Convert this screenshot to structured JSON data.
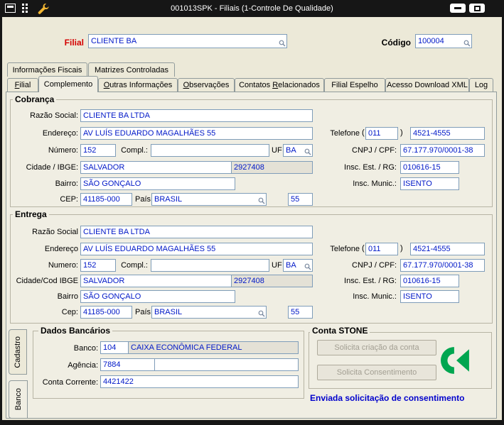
{
  "titlebar": {
    "title": "001013SPK - Filiais (1-Controle De Qualidade)"
  },
  "header": {
    "filial_label": "Filial",
    "filial_value": "CLIENTE BA",
    "codigo_label": "Código",
    "codigo_value": "100004"
  },
  "top_tabs": {
    "fiscais": "Informações Fiscais",
    "matrizes": "Matrizes Controladas"
  },
  "main_tabs": {
    "filial": {
      "label": "Filial",
      "u": "0"
    },
    "complemento": {
      "label": "Complemento"
    },
    "outras": {
      "label": "Outras Informações",
      "u": "0"
    },
    "observacoes": {
      "label": "Observações",
      "u": "0"
    },
    "contatos": {
      "label": "Contatos Relacionados",
      "u": "9"
    },
    "espelho": {
      "label": "Filial Espelho"
    },
    "xml": {
      "label": "Acesso Download XML"
    },
    "log": {
      "label": "Log"
    }
  },
  "cobranca": {
    "title": "Cobrança",
    "labels": {
      "razao": "Razão Social:",
      "endereco": "Endereço:",
      "numero": "Número:",
      "compl": "Compl.:",
      "uf": "UF",
      "cidade": "Cidade / IBGE:",
      "bairro": "Bairro:",
      "cep": "CEP:",
      "pais": "País",
      "telefone": "Telefone",
      "paren_open": "(",
      "paren_close": ")",
      "cnpj": "CNPJ / CPF:",
      "insc_est": "Insc. Est. / RG:",
      "insc_mun": "Insc. Munic.:"
    },
    "values": {
      "razao": "CLIENTE BA LTDA",
      "endereco": "AV LUÍS EDUARDO MAGALHÃES 55",
      "numero": "152",
      "compl": "",
      "uf": "BA",
      "cidade": "SALVADOR",
      "ibge": "2927408",
      "bairro": "SÃO GONÇALO",
      "cep": "41185-000",
      "pais": "BRASIL",
      "pais_cod": "55",
      "ddd": "011",
      "fone": "4521-4555",
      "cnpj": "67.177.970/0001-38",
      "insc_est": "010616-15",
      "insc_mun": "ISENTO"
    }
  },
  "entrega": {
    "title": "Entrega",
    "labels": {
      "razao": "Razão Social",
      "endereco": "Endereço",
      "numero": "Numero:",
      "compl": "Compl.:",
      "uf": "UF",
      "cidade": "Cidade/Cod IBGE",
      "bairro": "Bairro",
      "cep": "Cep:",
      "pais": "País",
      "telefone": "Telefone",
      "paren_open": "(",
      "paren_close": ")",
      "cnpj": "CNPJ / CPF:",
      "insc_est": "Insc. Est. / RG:",
      "insc_mun": "Insc. Munic.:"
    },
    "values": {
      "razao": "CLIENTE BA LTDA",
      "endereco": "AV LUÍS EDUARDO MAGALHÃES 55",
      "numero": "152",
      "compl": "",
      "uf": "BA",
      "cidade": "SALVADOR",
      "ibge": "2927408",
      "bairro": "SÃO GONÇALO",
      "cep": "41185-000",
      "pais": "BRASIL",
      "pais_cod": "55",
      "ddd": "011",
      "fone": "4521-4555",
      "cnpj": "67.177.970/0001-38",
      "insc_est": "010616-15",
      "insc_mun": "ISENTO"
    }
  },
  "side_tabs": {
    "cadastro": "Cadastro",
    "banco": "Banco"
  },
  "dados_bancarios": {
    "title": "Dados Bancários",
    "labels": {
      "banco": "Banco:",
      "agencia": "Agência:",
      "conta": "Conta Corrente:"
    },
    "values": {
      "banco_cod": "104",
      "banco_nome": "CAIXA ECONÔMICA FEDERAL",
      "agencia": "7884",
      "conta": "4421422"
    }
  },
  "conta_stone": {
    "title": "Conta STONE",
    "btn_criacao": "Solicita criação da conta",
    "btn_consent": "Solicita Consentimento",
    "status": "Enviada solicitação de consentimento"
  },
  "colors": {
    "field_text": "#0018c8",
    "filial_label": "#d40000",
    "status_text": "#0000cc",
    "stone_green": "#00a650",
    "titlebar_bg": "#161616",
    "form_bg": "#ece9d8"
  }
}
